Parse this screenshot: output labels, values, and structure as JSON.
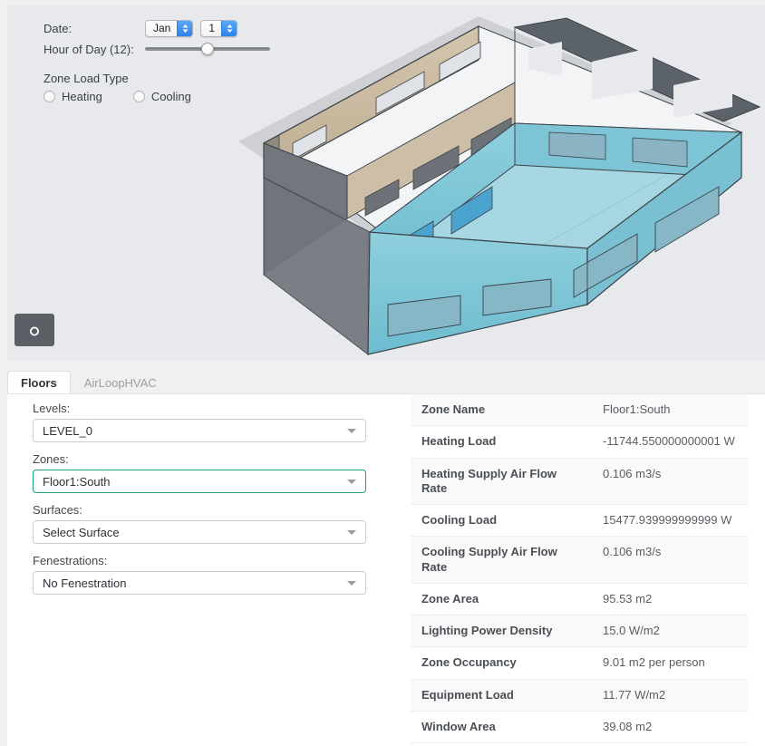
{
  "controls": {
    "date_label": "Date:",
    "month": "Jan",
    "day": "1",
    "hour_label": "Hour of Day (12):",
    "hour_value": 12,
    "hour_percent": 50,
    "zone_load_type_label": "Zone Load Type",
    "heating_label": "Heating",
    "cooling_label": "Cooling",
    "heating_selected": false,
    "cooling_selected": false,
    "camera_icon": "camera-icon"
  },
  "tabs": [
    {
      "label": "Floors",
      "active": true
    },
    {
      "label": "AirLoopHVAC",
      "active": false
    }
  ],
  "form": {
    "levels_label": "Levels:",
    "levels_value": "LEVEL_0",
    "zones_label": "Zones:",
    "zones_value": "Floor1:South",
    "surfaces_label": "Surfaces:",
    "surfaces_value": "Select Surface",
    "fenestrations_label": "Fenestrations:",
    "fenestrations_value": "No Fenestration",
    "focus_accent": "#1aa179"
  },
  "properties": [
    {
      "key": "Zone Name",
      "value": "Floor1:South"
    },
    {
      "key": "Heating Load",
      "value": "-11744.550000000001 W"
    },
    {
      "key": "Heating Supply Air Flow Rate",
      "value": "0.106 m3/s"
    },
    {
      "key": "Cooling Load",
      "value": "15477.939999999999 W"
    },
    {
      "key": "Cooling Supply Air Flow Rate",
      "value": "0.106 m3/s"
    },
    {
      "key": "Zone Area",
      "value": "95.53 m2"
    },
    {
      "key": "Lighting Power Density",
      "value": "15.0 W/m2"
    },
    {
      "key": "Zone Occupancy",
      "value": "9.01 m2 per person"
    },
    {
      "key": "Equipment Load",
      "value": "11.77 W/m2"
    },
    {
      "key": "Window Area",
      "value": "39.08 m2"
    }
  ],
  "model": {
    "description": "3D building massing model, one floor, hip roof outline, with selected south zone highlighted",
    "viewport_background": "#e7e9ec",
    "unselected_zone_color": "#cbbda6",
    "selected_zone_color": "#7dc4d6",
    "shadow_color": "#b9bcc0",
    "edge_color": "#3c4248",
    "window_color": "#d2d7dc",
    "selected_window_color": "#4aa3cf"
  }
}
